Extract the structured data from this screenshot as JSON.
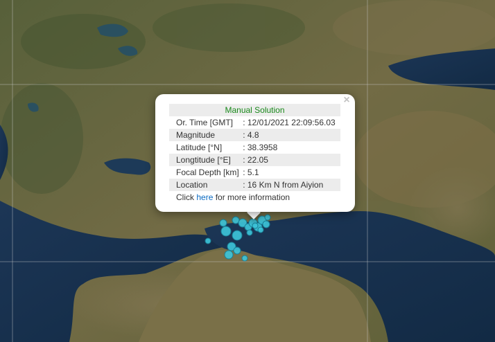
{
  "popup": {
    "title": "Manual Solution",
    "close_symbol": "×",
    "rows": [
      {
        "label": "Or. Time [GMT]",
        "value": ": 12/01/2021 22:09:56.03"
      },
      {
        "label": "Magnitude",
        "value": ": 4.8"
      },
      {
        "label": "Latitude [°N]",
        "value": ": 38.3958"
      },
      {
        "label": "Longtitude [°E]",
        "value": ": 22.05"
      },
      {
        "label": "Focal Depth [km]",
        "value": ": 5.1"
      },
      {
        "label": "Location",
        "value": ": 16 Km N from Aiyion"
      }
    ],
    "footer": {
      "before": "Click ",
      "link": "here",
      "after": " for more information"
    }
  },
  "colors": {
    "title_green": "#18881a",
    "link_blue": "#0a6ac2",
    "marker_fill": "#3dc3d8",
    "marker_stroke": "#1a7f95",
    "sea": "#18304a",
    "land": "#6e6a45"
  },
  "icons": {
    "close": "close-icon",
    "marker": "earthquake-marker"
  }
}
